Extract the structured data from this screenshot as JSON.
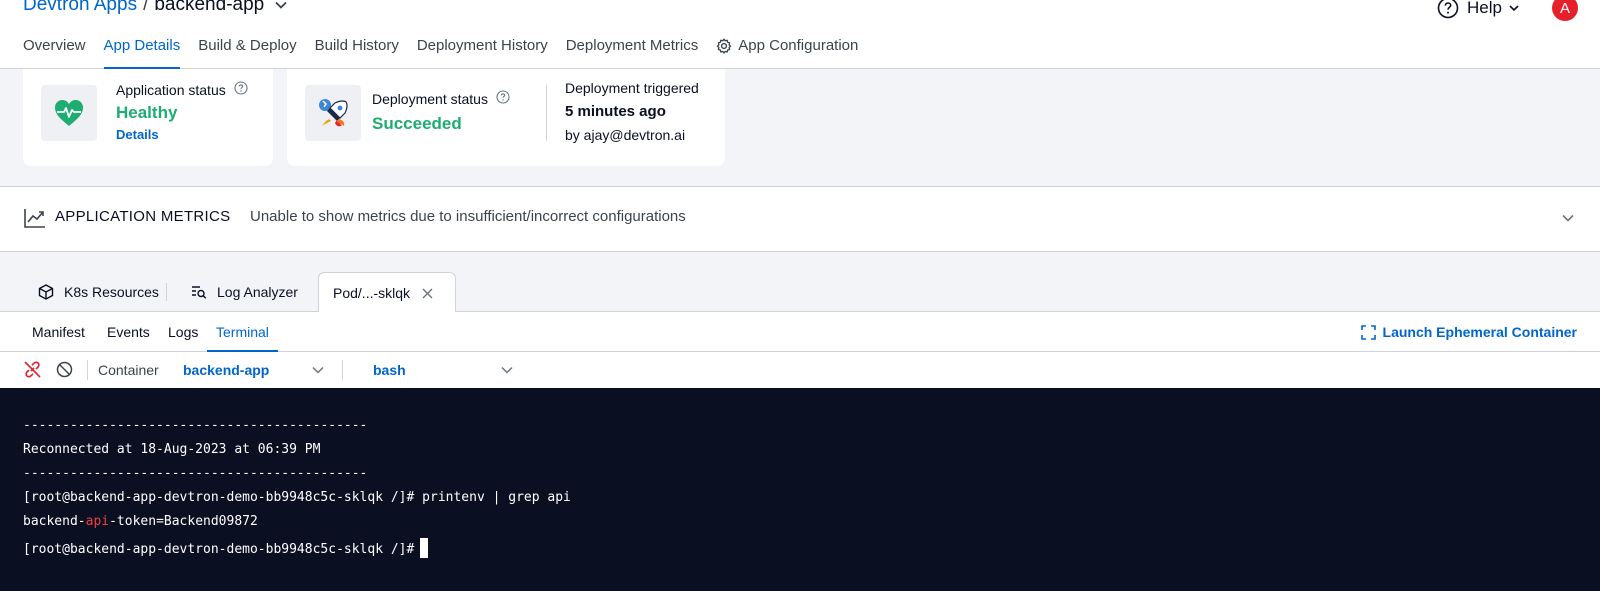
{
  "header": {
    "breadcrumb_root": "Devtron Apps",
    "breadcrumb_sep": "/",
    "app_name": "backend-app",
    "help_label": "Help",
    "avatar_initial": "A",
    "tabs": [
      {
        "label": "Overview"
      },
      {
        "label": "App Details"
      },
      {
        "label": "Build & Deploy"
      },
      {
        "label": "Build History"
      },
      {
        "label": "Deployment History"
      },
      {
        "label": "Deployment Metrics"
      },
      {
        "label": "App Configuration"
      }
    ],
    "active_tab": "App Details"
  },
  "app_status": {
    "label": "Application status",
    "value": "Healthy",
    "details_link": "Details",
    "icon": "heart-pulse-icon"
  },
  "deployment_status": {
    "label": "Deployment status",
    "value": "Succeeded",
    "icon": "rocket-icon",
    "triggered_label": "Deployment triggered",
    "triggered_time": "5 minutes ago",
    "triggered_by": "by ajay@devtron.ai"
  },
  "metrics": {
    "title": "APPLICATION METRICS",
    "message": "Unable to show metrics due to insufficient/incorrect configurations"
  },
  "resource_tabs": {
    "k8s": "K8s Resources",
    "log_analyzer": "Log Analyzer",
    "pod": "Pod/...-sklqk"
  },
  "sub_tabs": {
    "items": [
      "Manifest",
      "Events",
      "Logs",
      "Terminal"
    ],
    "active": "Terminal",
    "ephemeral": "Launch Ephemeral Container"
  },
  "toolbar": {
    "container_label": "Container",
    "container_value": "backend-app",
    "shell_value": "bash"
  },
  "terminal": {
    "line1": "--------------------------------------------",
    "line2": "Reconnected at 18-Aug-2023 at 06:39 PM",
    "line3": "--------------------------------------------",
    "line4": "[root@backend-app-devtron-demo-bb9948c5c-sklqk /]# printenv | grep api",
    "line5_pre": "backend-",
    "line5_hl": "api",
    "line5_post": "-token=Backend09872",
    "line6": "[root@backend-app-devtron-demo-bb9948c5c-sklqk /]#"
  },
  "colors": {
    "accent": "#0066cc",
    "success": "#1dad70",
    "danger": "#e5202b",
    "terminal_bg": "#0b0f22"
  }
}
